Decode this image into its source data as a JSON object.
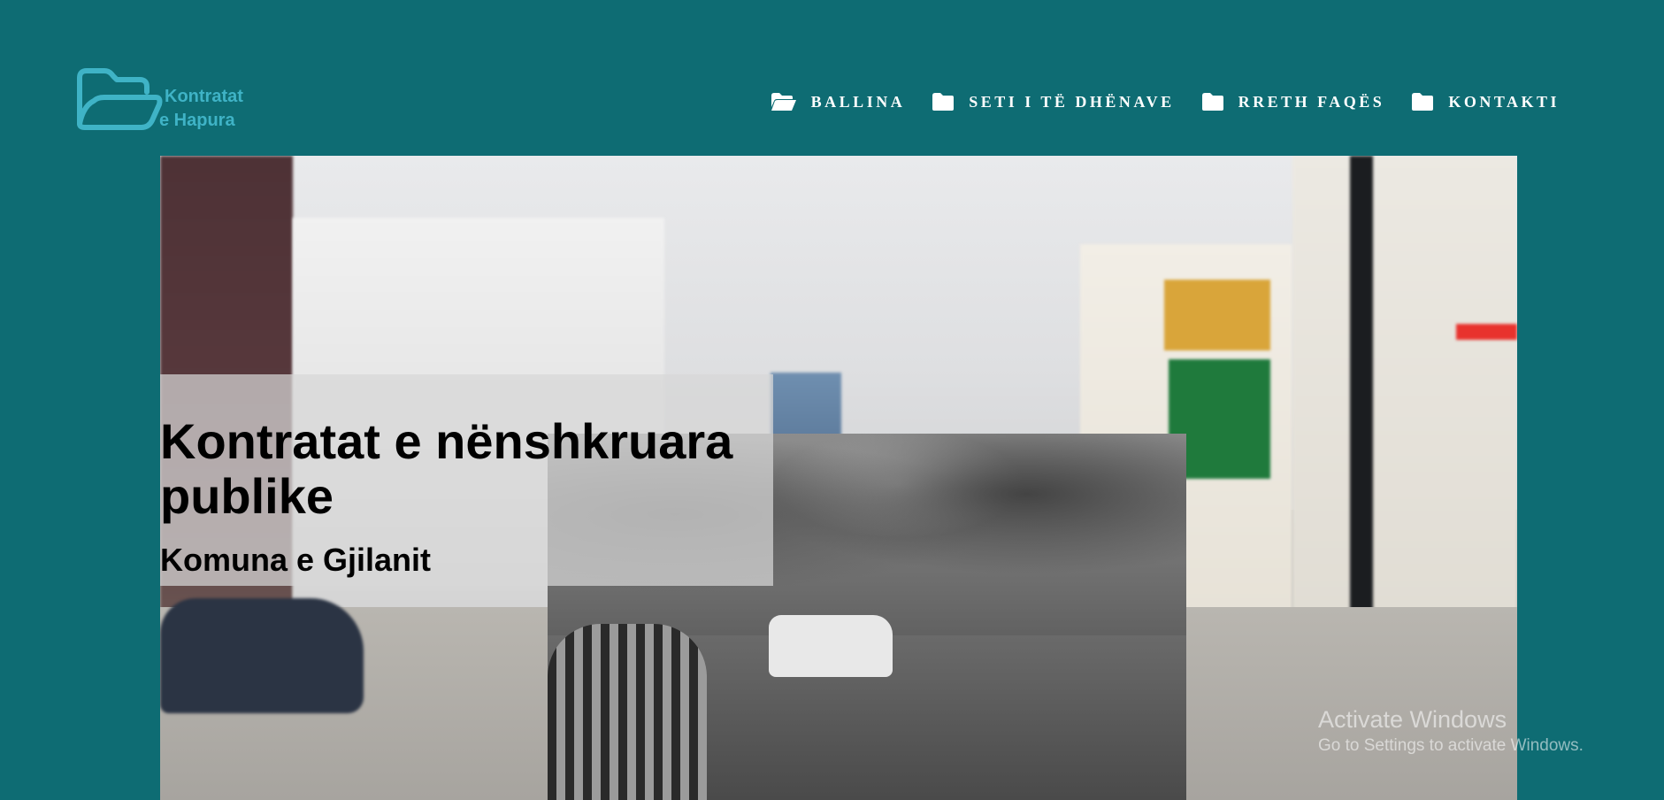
{
  "logo": {
    "line1": "Kontratat",
    "line2": "e Hapura",
    "icon": "folder-outline-icon",
    "color": "#3fb3c6"
  },
  "nav": {
    "items": [
      {
        "label": "BALLINA",
        "icon": "folder-open-icon"
      },
      {
        "label": "SETI I TË DHËNAVE",
        "icon": "folder-icon"
      },
      {
        "label": "RRETH FAQËS",
        "icon": "folder-icon"
      },
      {
        "label": "KONTAKTI",
        "icon": "folder-icon"
      }
    ]
  },
  "hero": {
    "title": "Kontratat e nënshkruara publike",
    "subtitle": "Komuna e Gjilanit"
  },
  "watermark": {
    "line1": "Activate Windows",
    "line2": "Go to Settings to activate Windows."
  },
  "colors": {
    "background": "#0e6c73",
    "nav_text": "#ffffff"
  }
}
